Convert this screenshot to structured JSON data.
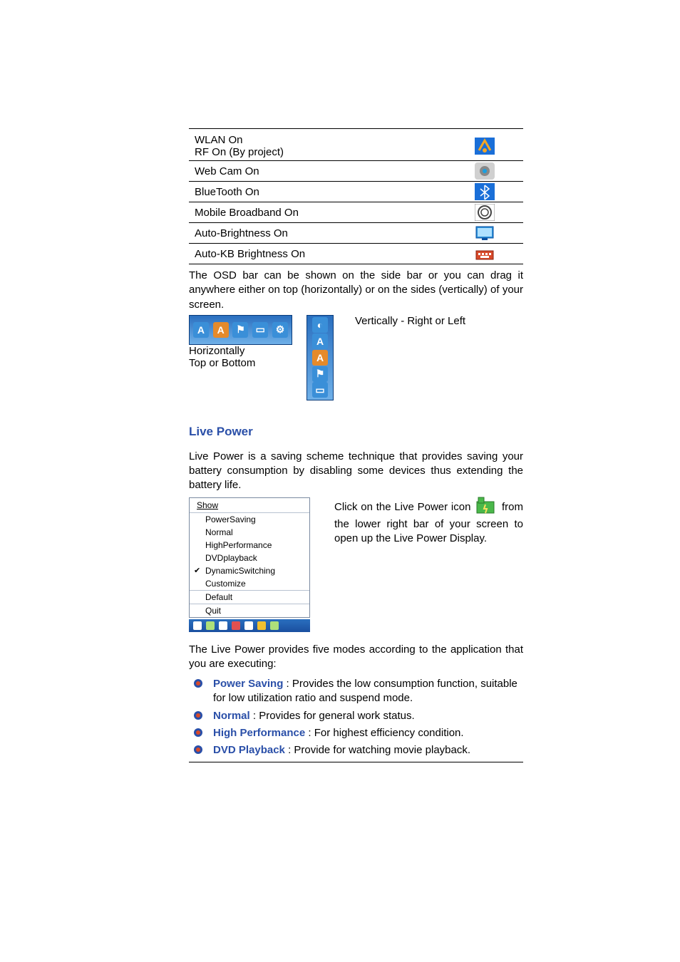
{
  "features": [
    {
      "label_line1": "WLAN On",
      "label_line2": "RF On (By project)",
      "icon": "wlan-icon"
    },
    {
      "label_line1": "Web Cam On",
      "icon": "webcam-icon"
    },
    {
      "label_line1": "BlueTooth On",
      "icon": "bluetooth-icon"
    },
    {
      "label_line1": "Mobile Broadband On",
      "icon": "broadband-icon"
    },
    {
      "label_line1": "Auto-Brightness On",
      "icon": "monitor-icon"
    },
    {
      "label_line1": "Auto-KB Brightness On",
      "icon": "keyboard-icon"
    }
  ],
  "osd": {
    "para": "The OSD bar can be shown on the side bar or you can drag it anywhere either on top (horizontally) or on the sides (vertically) of your screen.",
    "horizontal_l1": "Horizontally",
    "horizontal_l2": "Top or Bottom",
    "vertical": "Vertically - Right or Left"
  },
  "live_power": {
    "heading": "Live Power",
    "intro": "Live Power is a saving scheme technique that provides saving your battery consumption by disabling some devices thus extending the battery life.",
    "menu": {
      "head": "Show",
      "items": [
        "PowerSaving",
        "Normal",
        "HighPerformance",
        "DVDplayback",
        "DynamicSwitching",
        "Customize"
      ],
      "checked_index": 4,
      "default": "Default",
      "quit": "Quit"
    },
    "right_part1": "Click on the Live Power icon",
    "right_part2": "from the lower right bar of your screen to open up the Live Power Display.",
    "modes_intro": "The Live Power provides five modes according to the application that you are executing:",
    "modes": [
      {
        "name": "Power Saving",
        "desc": ": Provides the low consumption function, suitable for low utilization ratio and suspend mode."
      },
      {
        "name": "Normal",
        "desc": ": Provides for general work status."
      },
      {
        "name": "High Performance",
        "desc": ": For highest efficiency condition."
      },
      {
        "name": "DVD Playback",
        "desc": ": Provide for watching movie playback."
      }
    ]
  }
}
